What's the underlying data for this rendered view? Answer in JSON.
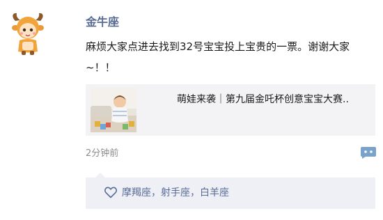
{
  "post": {
    "username": "金牛座",
    "text": "麻烦大家点进去找到32号宝宝投上宝贵的一票。谢谢大家~！！",
    "timestamp": "2分钟前"
  },
  "link_card": {
    "title": "萌娃来袭｜第九届金吒杯创意宝宝大赛.."
  },
  "likes": {
    "names": "摩羯座，射手座，白羊座"
  },
  "icons": {
    "avatar": "taurus-cartoon-avatar",
    "comment": "comment-dots-icon",
    "like": "heart-outline-icon"
  },
  "colors": {
    "name_link": "#576b95",
    "card_bg": "#f3f3f5",
    "likes_bg": "#eff0f6",
    "comment_icon": "#7aa3cc"
  }
}
